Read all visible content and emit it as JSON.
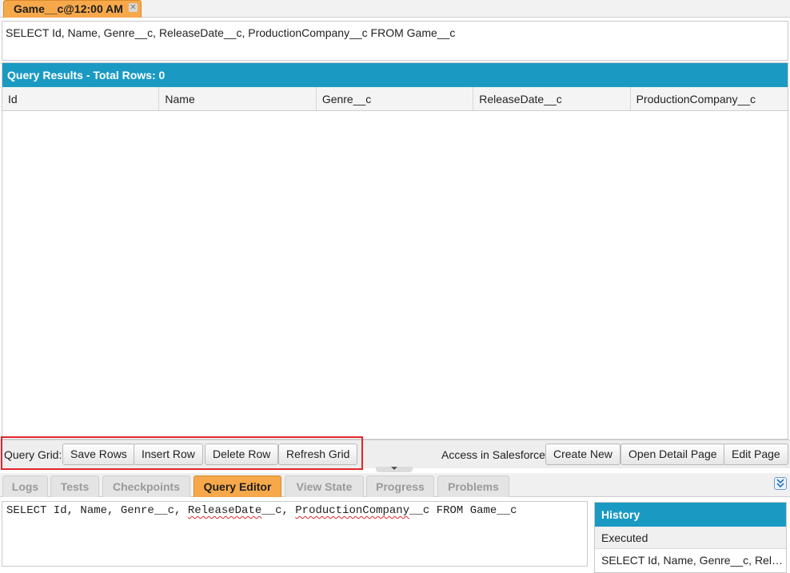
{
  "result_tab": {
    "label": "Game__c@12:00 AM",
    "close_glyph": "✕"
  },
  "query_text": "SELECT Id, Name, Genre__c, ReleaseDate__c, ProductionCompany__c FROM Game__c",
  "results": {
    "header": "Query Results - Total Rows: 0",
    "columns": [
      "Id",
      "Name",
      "Genre__c",
      "ReleaseDate__c",
      "ProductionCompany__c"
    ],
    "rows": []
  },
  "toolbar": {
    "query_grid_label": "Query Grid:",
    "save_rows": "Save Rows",
    "insert_row": "Insert Row",
    "delete_row": "Delete Row",
    "refresh_grid": "Refresh Grid",
    "salesforce_label": "Access in Salesforce:",
    "create_new": "Create New",
    "open_detail_page": "Open Detail Page",
    "edit_page": "Edit Page"
  },
  "bottom_tabs": [
    "Logs",
    "Tests",
    "Checkpoints",
    "Query Editor",
    "View State",
    "Progress",
    "Problems"
  ],
  "active_bottom_tab": "Query Editor",
  "editor": {
    "part1": "SELECT Id, Name, Genre__c, ",
    "part2": "ReleaseDate",
    "part3": "__c, ",
    "part4": "ProductionCompany",
    "part5": "__c FROM Game__c"
  },
  "history": {
    "title": "History",
    "subheader": "Executed",
    "items": [
      "SELECT Id, Name, Genre__c, Rele..."
    ]
  },
  "colors": {
    "accent_blue": "#1a9ac3",
    "active_tab_orange": "#f6a84a",
    "highlight_red": "#e0262b"
  },
  "icons": {
    "close": "close-icon",
    "collapse": "double-chevron-down-icon",
    "splitter": "splitter-handle-icon"
  }
}
